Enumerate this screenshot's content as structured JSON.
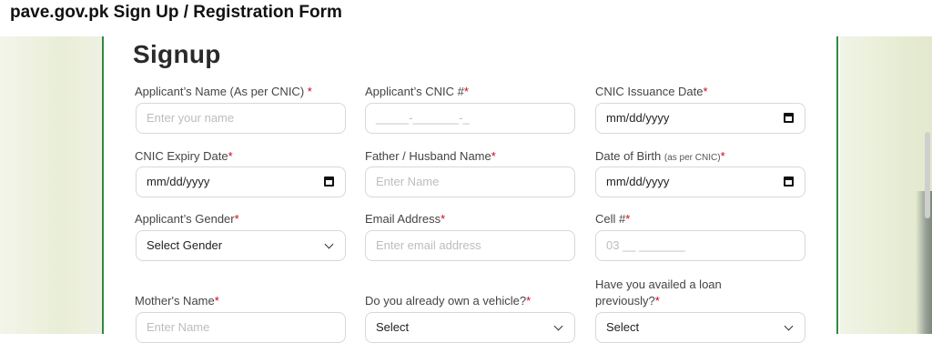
{
  "page_heading": "pave.gov.pk Sign Up / Registration Form",
  "form": {
    "title": "Signup",
    "required_mark": "*",
    "fields": {
      "applicant_name": {
        "label": "Applicant’s Name (As per CNIC)",
        "required": " *",
        "placeholder": "Enter your name"
      },
      "applicant_cnic": {
        "label": "Applicant’s CNIC #",
        "required": "*",
        "placeholder": "_____-_______-_"
      },
      "cnic_issuance_date": {
        "label": "CNIC Issuance Date",
        "required": "*",
        "value": "mm/dd/yyyy",
        "icon": "calendar-icon"
      },
      "cnic_expiry_date": {
        "label": "CNIC Expiry Date",
        "required": "*",
        "value": "mm/dd/yyyy",
        "icon": "calendar-icon"
      },
      "father_husband_name": {
        "label": "Father / Husband Name",
        "required": "*",
        "placeholder": "Enter Name"
      },
      "date_of_birth": {
        "label": "Date of Birth",
        "label_note": "(as per CNIC)",
        "required": "*",
        "value": "mm/dd/yyyy",
        "icon": "calendar-icon"
      },
      "applicant_gender": {
        "label": "Applicant’s Gender",
        "required": "*",
        "value": "Select Gender",
        "icon": "chevron-down-icon"
      },
      "email_address": {
        "label": "Email Address",
        "required": "*",
        "placeholder": "Enter email address"
      },
      "cell": {
        "label": "Cell #",
        "required": "*",
        "placeholder": "03 __ _______"
      },
      "mother_name": {
        "label": "Mother's Name",
        "required": "*",
        "placeholder": "Enter Name"
      },
      "own_vehicle": {
        "label": "Do you already own a vehicle?",
        "required": "*",
        "value": "Select",
        "icon": "chevron-down-icon"
      },
      "availed_loan": {
        "label_line1": "Have you availed a loan",
        "label_line2": "previously?",
        "required": "*",
        "value": "Select",
        "icon": "chevron-down-icon"
      }
    }
  },
  "colors": {
    "accent_green": "#2e8b3e",
    "required_red": "#d0021b"
  }
}
